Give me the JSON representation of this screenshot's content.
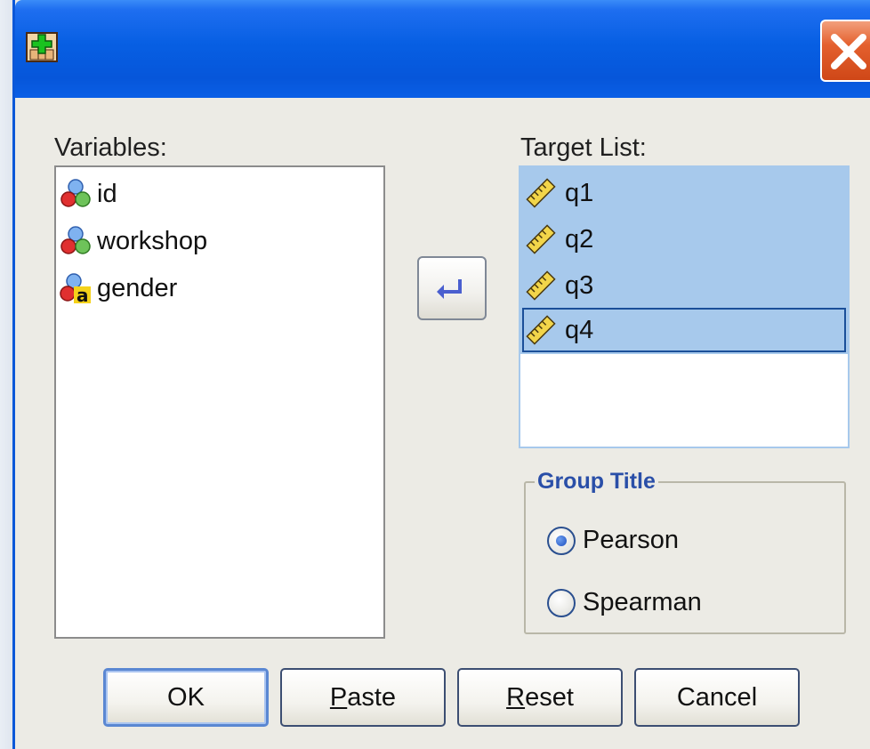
{
  "dialog": {
    "variables_label": "Variables:",
    "target_label": "Target List:",
    "variables": [
      {
        "name": "id",
        "icon": "nominal-numeric-icon"
      },
      {
        "name": "workshop",
        "icon": "nominal-numeric-icon"
      },
      {
        "name": "gender",
        "icon": "nominal-string-icon"
      }
    ],
    "targets": [
      {
        "name": "q1",
        "icon": "scale-ruler-icon"
      },
      {
        "name": "q2",
        "icon": "scale-ruler-icon"
      },
      {
        "name": "q3",
        "icon": "scale-ruler-icon"
      },
      {
        "name": "q4",
        "icon": "scale-ruler-icon"
      }
    ],
    "group": {
      "title": "Group Title",
      "options": [
        {
          "label": "Pearson",
          "checked": true
        },
        {
          "label": "Spearman",
          "checked": false
        }
      ]
    },
    "buttons": {
      "ok": "OK",
      "paste_accel": "P",
      "paste_rest": "aste",
      "reset_accel": "R",
      "reset_rest": "eset",
      "cancel": "Cancel"
    }
  },
  "colors": {
    "titlebar": "#0656da",
    "selection": "#a7c9ec",
    "close": "#e4602e",
    "group_title": "#2a4fa8"
  }
}
